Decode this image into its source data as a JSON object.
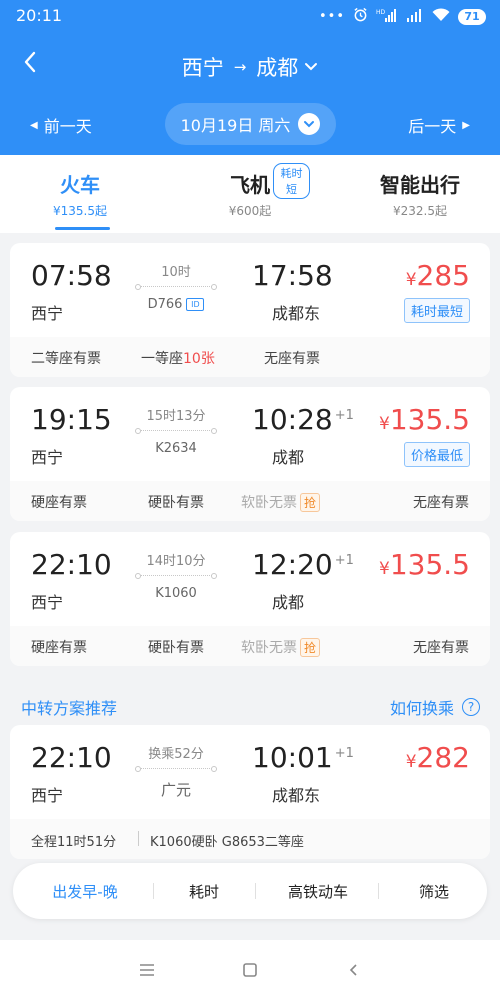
{
  "status": {
    "time": "20:11",
    "battery": "71"
  },
  "header": {
    "from": "西宁",
    "to": "成都",
    "arrow": "→",
    "date": "10月19日 周六",
    "prev_day": "前一天",
    "next_day": "后一天"
  },
  "tabs": [
    {
      "name": "火车",
      "price": "¥135.5起"
    },
    {
      "name": "飞机",
      "price": "¥600起",
      "badge": "耗时短"
    },
    {
      "name": "智能出行",
      "price": "¥232.5起"
    }
  ],
  "trains": [
    {
      "dep_time": "07:58",
      "dep_station": "西宁",
      "duration": "10时",
      "train_no": "D766",
      "arr_time": "17:58",
      "arr_plus": "",
      "arr_station": "成都东",
      "price_yen": "¥",
      "price": "285",
      "tag": "耗时最短",
      "seats": [
        {
          "label": "二等座有票"
        },
        {
          "label": "一等座",
          "count": "10张"
        },
        {
          "label": "无座有票"
        }
      ]
    },
    {
      "dep_time": "19:15",
      "dep_station": "西宁",
      "duration": "15时13分",
      "train_no": "K2634",
      "arr_time": "10:28",
      "arr_plus": "+1",
      "arr_station": "成都",
      "price_yen": "¥",
      "price": "135.5",
      "tag": "价格最低",
      "seats": [
        {
          "label": "硬座有票"
        },
        {
          "label": "硬卧有票"
        },
        {
          "label": "软卧无票",
          "grab": "抢"
        },
        {
          "label": "无座有票"
        }
      ]
    },
    {
      "dep_time": "22:10",
      "dep_station": "西宁",
      "duration": "14时10分",
      "train_no": "K1060",
      "arr_time": "12:20",
      "arr_plus": "+1",
      "arr_station": "成都",
      "price_yen": "¥",
      "price": "135.5",
      "seats": [
        {
          "label": "硬座有票"
        },
        {
          "label": "硬卧有票"
        },
        {
          "label": "软卧无票",
          "grab": "抢"
        },
        {
          "label": "无座有票"
        }
      ]
    }
  ],
  "transfer_section": {
    "title": "中转方案推荐",
    "link": "如何换乘",
    "help": "?"
  },
  "transfer": {
    "dep_time": "22:10",
    "dep_station": "西宁",
    "transfer_info": "换乘52分",
    "transfer_station": "广元",
    "arr_time": "10:01",
    "arr_plus": "+1",
    "arr_station": "成都东",
    "price_yen": "¥",
    "price": "282",
    "total": "全程11时51分",
    "route": "K1060硬卧 G8653二等座"
  },
  "filters": [
    "出发早-晚",
    "耗时",
    "高铁动车",
    "筛选"
  ],
  "colors": {
    "primary": "#2f8ff7",
    "price": "#f04d4d",
    "grab": "#f08a2a"
  }
}
